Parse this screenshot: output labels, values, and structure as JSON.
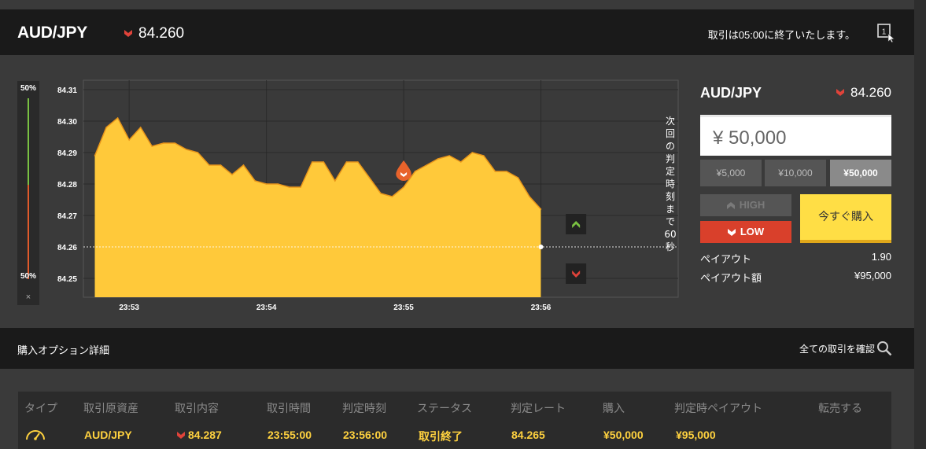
{
  "header": {
    "pair": "AUD/JPY",
    "rate": "84.260",
    "close_message": "取引は05:00に終了いたします。",
    "panel_icon": "window-number-icon",
    "panel_number": "1"
  },
  "meter": {
    "top_pct": "50%",
    "bottom_pct": "50%",
    "close_label": "×",
    "high_share": 0.5,
    "low_share": 0.5
  },
  "countdown": {
    "text": "次回の判定時刻まで60秒"
  },
  "chart_data": {
    "type": "area",
    "series": [
      {
        "x": [
          "23:52:45",
          "23:52:50",
          "23:52:55",
          "23:53:00",
          "23:53:05",
          "23:53:10",
          "23:53:15",
          "23:53:20",
          "23:53:25",
          "23:53:30",
          "23:53:35",
          "23:53:40",
          "23:53:45",
          "23:53:50",
          "23:53:55",
          "23:54:00",
          "23:54:05",
          "23:54:10",
          "23:54:15",
          "23:54:20",
          "23:54:25",
          "23:54:30",
          "23:54:35",
          "23:54:40",
          "23:54:45",
          "23:54:50",
          "23:54:55",
          "23:55:00",
          "23:55:05",
          "23:55:10",
          "23:55:15",
          "23:55:20",
          "23:55:25",
          "23:55:30",
          "23:55:35",
          "23:55:40",
          "23:55:45",
          "23:55:50",
          "23:55:55",
          "23:56:00"
        ],
        "y": [
          84.289,
          84.298,
          84.301,
          84.294,
          84.298,
          84.292,
          84.293,
          84.293,
          84.291,
          84.29,
          84.286,
          84.286,
          84.283,
          84.286,
          84.281,
          84.28,
          84.28,
          84.279,
          84.279,
          84.287,
          84.287,
          84.281,
          84.287,
          84.287,
          84.282,
          84.277,
          84.276,
          84.279,
          84.284,
          84.286,
          84.288,
          84.289,
          84.287,
          84.29,
          84.289,
          84.284,
          84.284,
          84.282,
          84.276,
          84.272
        ]
      }
    ],
    "yticks": [
      "84.31",
      "84.30",
      "84.29",
      "84.28",
      "84.27",
      "84.26",
      "84.25"
    ],
    "xticks": [
      "23:53",
      "23:54",
      "23:55",
      "23:56"
    ],
    "ylim": [
      84.244,
      84.313
    ],
    "xlim": [
      "23:52:40",
      "23:57:00"
    ],
    "current_rate": 84.26,
    "entry_marker": {
      "x": "23:55:00",
      "y": 84.284
    },
    "fill_color": "#ffc93a",
    "line_color": "#e8951a",
    "grid": true
  },
  "order": {
    "pair": "AUD/JPY",
    "rate": "84.260",
    "amount": "¥ 50,000",
    "presets": [
      "¥5,000",
      "¥10,000",
      "¥50,000"
    ],
    "selected_preset": 2,
    "high_label": "HIGH",
    "low_label": "LOW",
    "buy_label": "今すぐ購入",
    "payout_label": "ペイアウト",
    "payout_value": "1.90",
    "payout_amount_label": "ペイアウト額",
    "payout_amount_value": "¥95,000"
  },
  "details": {
    "title": "購入オプション詳細",
    "all_trades_link": "全ての取引を確認"
  },
  "table": {
    "headers": [
      "タイプ",
      "取引原資産",
      "取引内容",
      "取引時間",
      "判定時刻",
      "ステータス",
      "判定レート",
      "購入",
      "判定時ペイアウト",
      "転売する"
    ],
    "row": {
      "type_icon": "timer-gauge-icon",
      "asset": "AUD/JPY",
      "direction": "low",
      "entry_rate": "84.287",
      "trade_time": "23:55:00",
      "judge_time": "23:56:00",
      "status": "取引終了",
      "judge_rate": "84.265",
      "purchase": "¥50,000",
      "payout": "¥95,000"
    }
  },
  "colors": {
    "low_red": "#d9402b",
    "high_green": "#7ac142",
    "accent_yellow": "#ffde45"
  }
}
